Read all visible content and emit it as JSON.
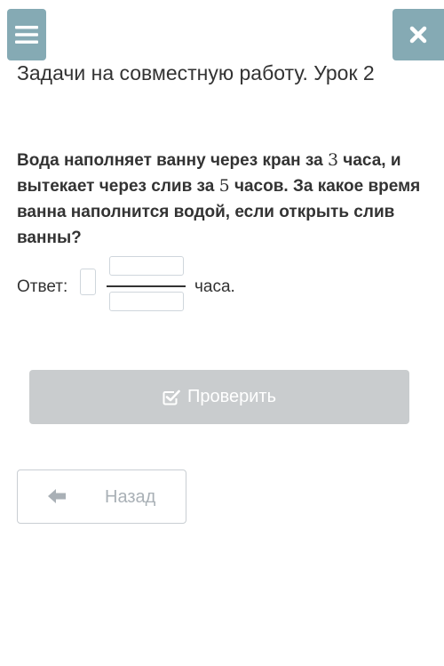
{
  "header": {
    "menu_icon": "hamburger-menu-icon",
    "close_icon": "close-x-icon",
    "title": "Задачи на совместную работу. Урок 2"
  },
  "question": {
    "part1": "Вода наполняет ванну через кран за ",
    "num1": "3",
    "part2": " часа, и вытекает через слив за ",
    "num2": "5",
    "part3": " часов. За какое время ванна наполнится водой, если открыть слив ванны?"
  },
  "answer": {
    "label": "Ответ:",
    "whole_value": "",
    "numerator_value": "",
    "denominator_value": "",
    "unit": "часа."
  },
  "buttons": {
    "check_label": "Проверить",
    "check_icon": "checkbox-check-icon",
    "back_label": "Назад",
    "back_icon": "arrow-left-icon"
  },
  "colors": {
    "top_button_bg": "#85aab4",
    "check_button_bg": "#c9ccce",
    "text": "#333333",
    "back_text": "#a9b0b6"
  }
}
